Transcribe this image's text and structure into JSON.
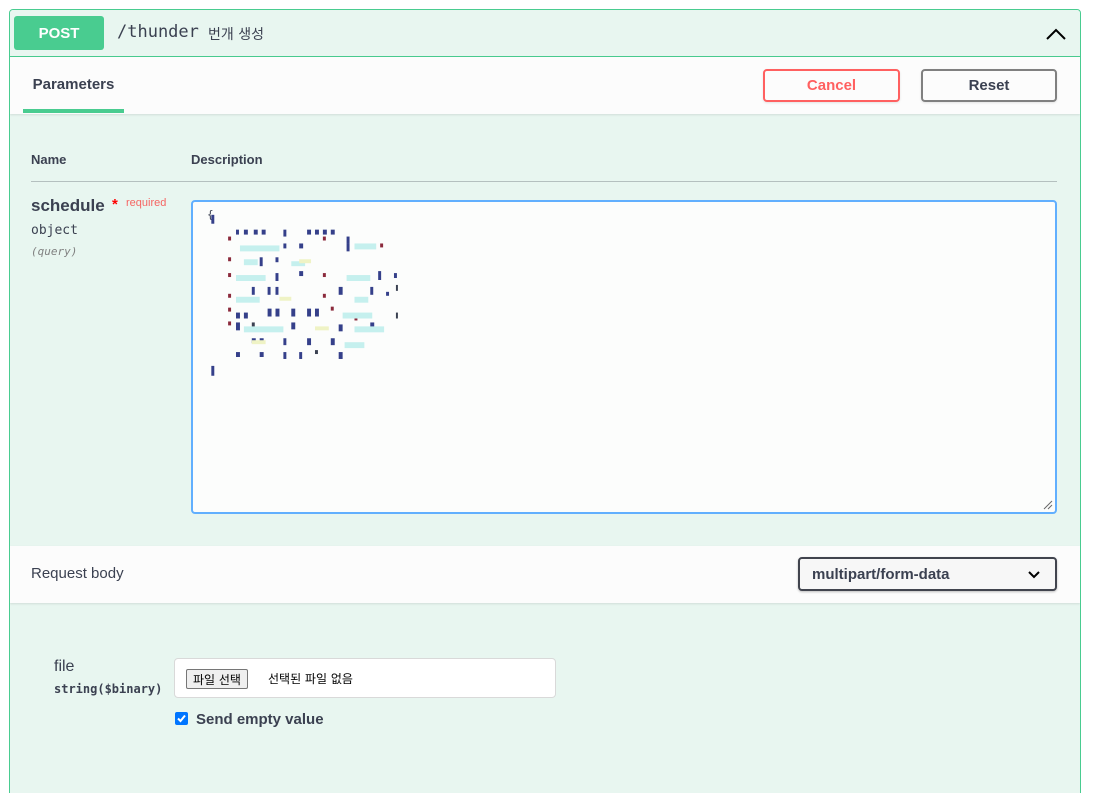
{
  "operation": {
    "method": "POST",
    "path": "/thunder",
    "summary": "번개 생성",
    "collapse_icon": "chevron-up-icon"
  },
  "parameters_section": {
    "tab_label": "Parameters",
    "cancel_label": "Cancel",
    "reset_label": "Reset",
    "col_name": "Name",
    "col_description": "Description"
  },
  "param": {
    "name": "schedule",
    "required_star": "*",
    "required_label": "required",
    "type": "object",
    "in": "(query)",
    "value_open": "{"
  },
  "request_body": {
    "title": "Request body",
    "content_type": "multipart/form-data",
    "dropdown_icon": "chevron-down-icon"
  },
  "file_field": {
    "label": "file",
    "type": "string($binary)",
    "choose_button": "파일 선택",
    "no_file_text": "선택된 파일 없음"
  },
  "send_empty": {
    "checked": true,
    "label": "Send empty value"
  },
  "colors": {
    "accent": "#49cc90",
    "cancel": "#ff6060",
    "focus": "#61affe"
  }
}
